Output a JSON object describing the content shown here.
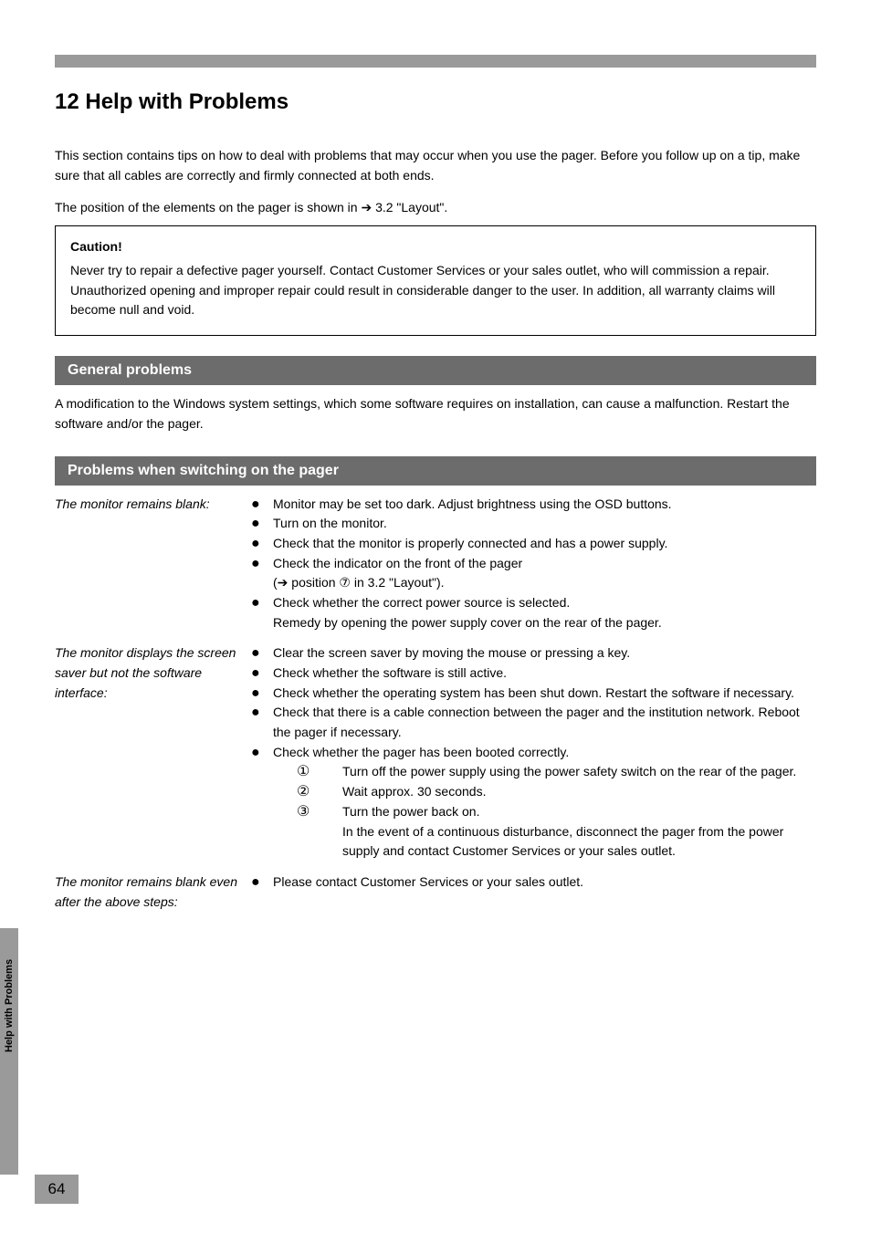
{
  "heading": "12  Help with Problems",
  "intro": "This section contains tips on how to deal with problems that may occur when you use the pager. Before you follow up on a tip, make sure that all cables are correctly and firmly connected at both ends.",
  "xref": {
    "pretext": "The position of the elements on the pager is shown in ",
    "arrow": "➔",
    "ref": " 3.2 \"Layout\"."
  },
  "warning": {
    "title": "Caution!",
    "body": "Never try to repair a defective pager yourself. Contact Customer Services or your sales outlet, who will commission a repair. Unauthorized opening and improper repair could result in considerable danger to the user. In addition, all warranty claims will become null and void."
  },
  "sections": {
    "general": {
      "title": "General problems",
      "body": "A modification to the Windows system settings, which some software requires on installation, can cause a malfunction. Restart the software and/or the pager."
    },
    "switchon": {
      "title": "Problems when switching on the pager",
      "rows": [
        {
          "label": "The monitor remains blank:",
          "items": [
            "Monitor may be set too dark. Adjust brightness using the OSD buttons.",
            "Turn on the monitor.",
            "Check that the monitor is properly connected and has a power supply.",
            "Check the indicator on the front of the pager\n(➔ position ⑦ in 3.2 \"Layout\").",
            "Check whether the correct power source is selected.\nRemedy by opening the power supply cover on the rear of the pager."
          ]
        },
        {
          "label": "The monitor displays the screen saver but not the software interface:",
          "items": [
            "Clear the screen saver by moving the mouse or pressing a key.",
            "Check whether the software is still active.",
            "Check whether the operating system has been shut down. Restart the software if necessary.",
            "Check that there is a cable connection between the pager and the institution network. Reboot the pager if necessary.",
            "Check whether the pager has been booted correctly."
          ],
          "steps": [
            "Turn off the power supply using the power safety switch on the rear of the pager.",
            "Wait approx. 30 seconds.",
            "Turn the power back on.\nIn the event of a continuous disturbance, disconnect the pager from the power supply and contact Customer Services or your sales outlet."
          ]
        },
        {
          "label": "The monitor remains blank even after the above steps:",
          "items": [
            "Please contact Customer Services or your sales outlet."
          ]
        }
      ]
    }
  },
  "sideTab": "Help with Problems",
  "pageNumber": "64"
}
